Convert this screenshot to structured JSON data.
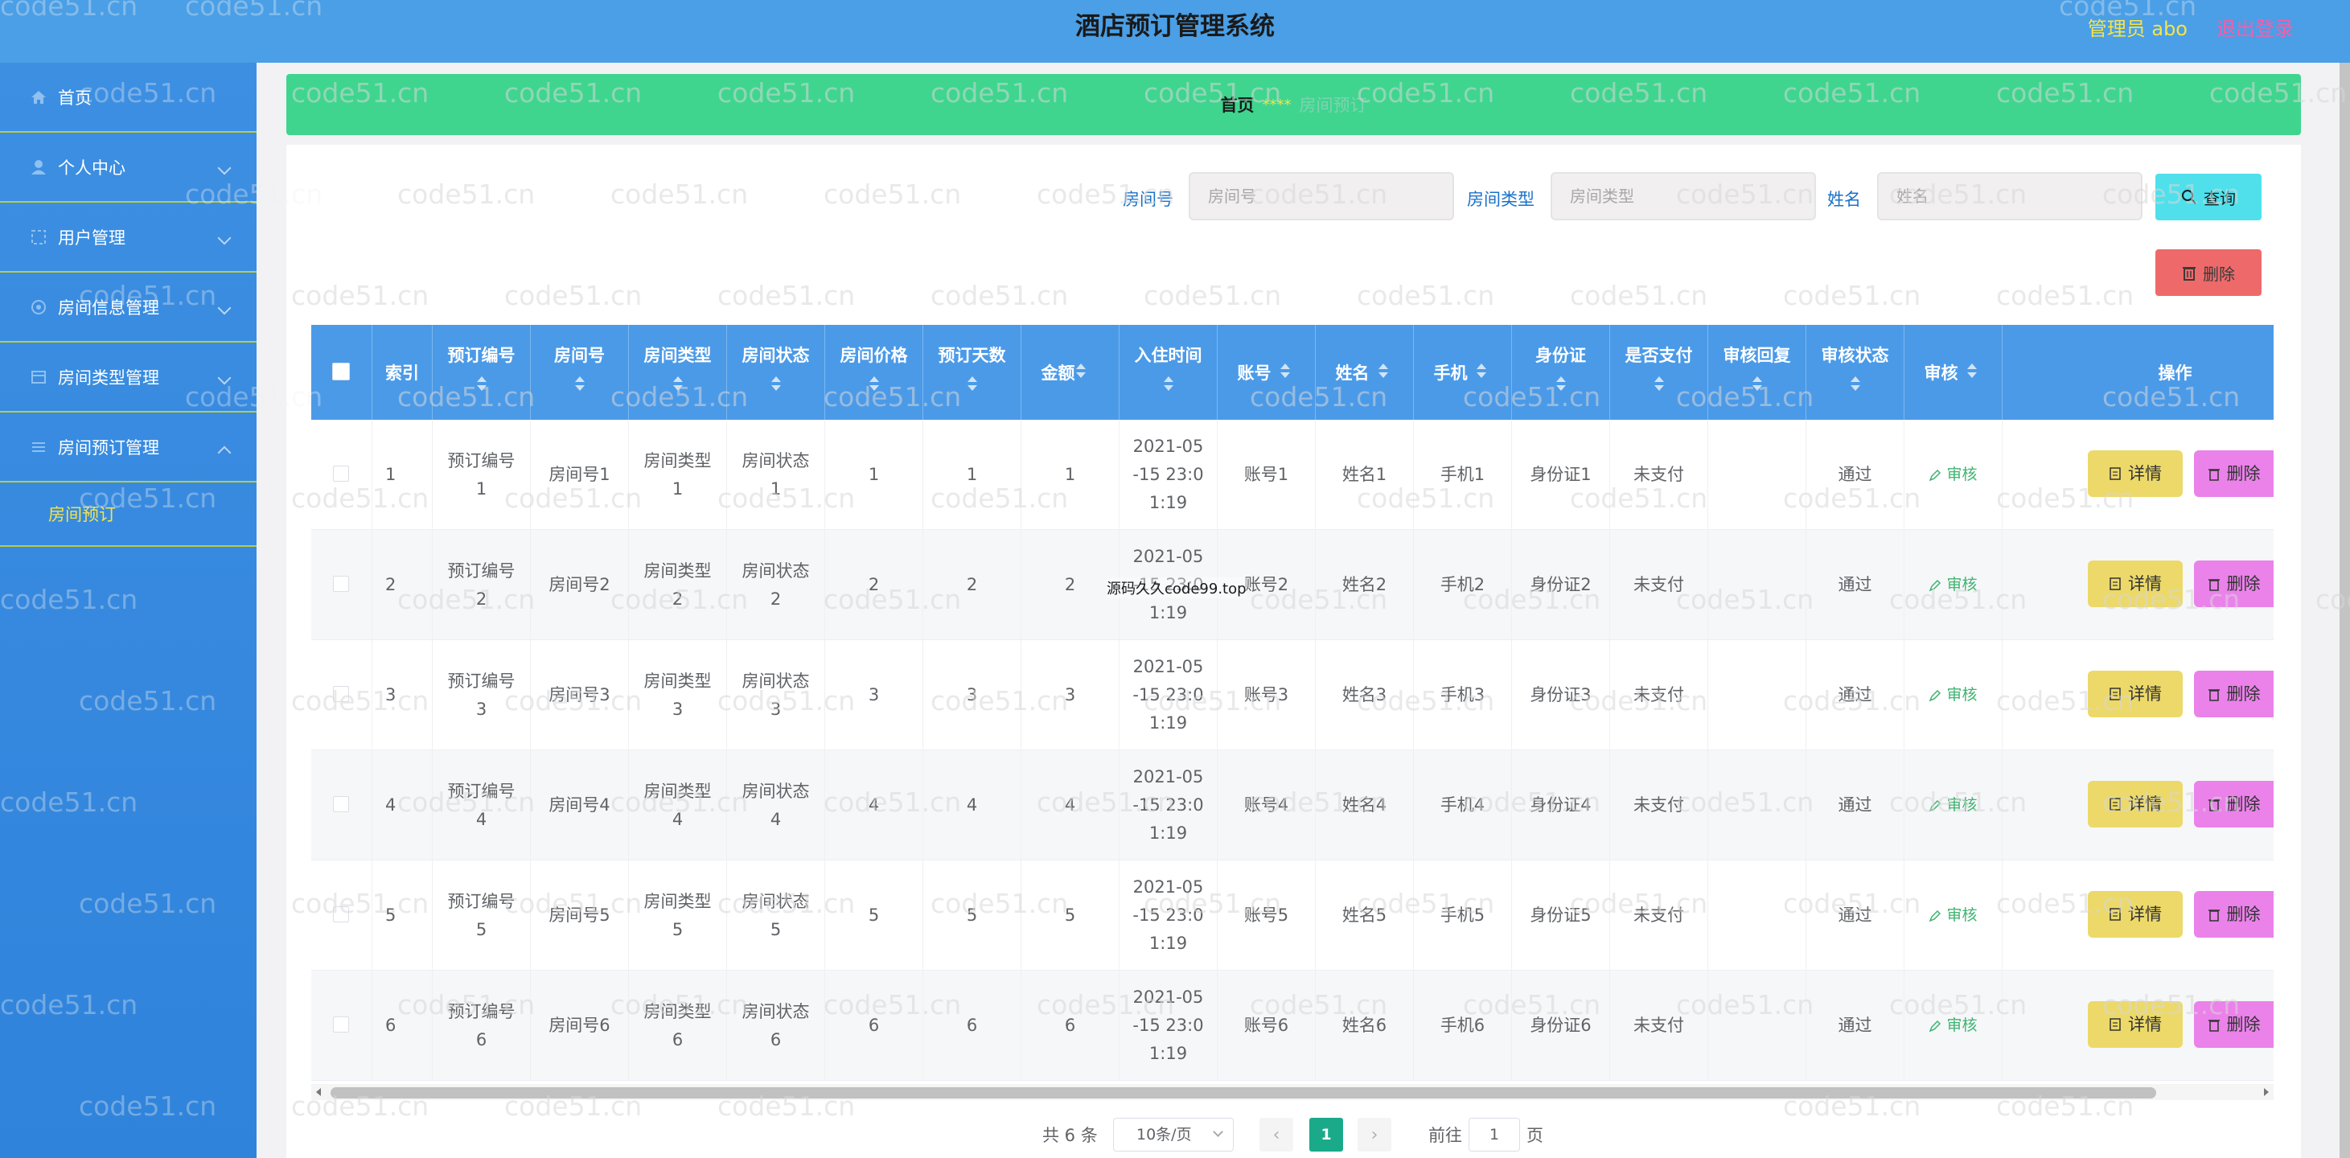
{
  "header": {
    "title": "酒店预订管理系统",
    "user": "管理员 abo",
    "logout": "退出登录"
  },
  "sidebar": {
    "items": [
      {
        "label": "首页",
        "icon": "home-icon",
        "chevron": ""
      },
      {
        "label": "个人中心",
        "icon": "user-icon",
        "chevron": "down"
      },
      {
        "label": "用户管理",
        "icon": "users-icon",
        "chevron": "down"
      },
      {
        "label": "房间信息管理",
        "icon": "gear-icon",
        "chevron": "down"
      },
      {
        "label": "房间类型管理",
        "icon": "grid-icon",
        "chevron": "down"
      },
      {
        "label": "房间预订管理",
        "icon": "list-icon",
        "chevron": "up"
      }
    ],
    "sub_item": "房间预订"
  },
  "breadcrumb": {
    "home": "首页",
    "separator": "****",
    "current": "房间预订"
  },
  "search": {
    "room_no_label": "房间号",
    "room_no_placeholder": "房间号",
    "room_type_label": "房间类型",
    "room_type_placeholder": "房间类型",
    "name_label": "姓名",
    "name_placeholder": "姓名",
    "search_btn": "查询",
    "delete_btn": "删除"
  },
  "table": {
    "columns": [
      "索引",
      "预订编号",
      "房间号",
      "房间类型",
      "房间状态",
      "房间价格",
      "预订天数",
      "金额",
      "入住时间",
      "账号",
      "姓名",
      "手机",
      "身份证",
      "是否支付",
      "审核回复",
      "审核状态",
      "审核",
      "操作"
    ],
    "audit_link": "审核",
    "detail_btn": "详情",
    "delete_btn": "删除",
    "rows": [
      {
        "idx": "1",
        "code": [
          "预订编号",
          "1"
        ],
        "room": "房间号1",
        "type": [
          "房间类型",
          "1"
        ],
        "status": [
          "房间状态",
          "1"
        ],
        "price": "1",
        "days": "1",
        "amount": "1",
        "checkin": [
          "2021-05",
          "-15 23:0",
          "1:19"
        ],
        "account": "账号1",
        "name": "姓名1",
        "phone": "手机1",
        "idcard": "身份证1",
        "paid": "未支付",
        "reply": "",
        "audit_status": "通过"
      },
      {
        "idx": "2",
        "code": [
          "预订编号",
          "2"
        ],
        "room": "房间号2",
        "type": [
          "房间类型",
          "2"
        ],
        "status": [
          "房间状态",
          "2"
        ],
        "price": "2",
        "days": "2",
        "amount": "2",
        "checkin": [
          "2021-05",
          "-15 23:0",
          "1:19"
        ],
        "account": "账号2",
        "name": "姓名2",
        "phone": "手机2",
        "idcard": "身份证2",
        "paid": "未支付",
        "reply": "",
        "audit_status": "通过"
      },
      {
        "idx": "3",
        "code": [
          "预订编号",
          "3"
        ],
        "room": "房间号3",
        "type": [
          "房间类型",
          "3"
        ],
        "status": [
          "房间状态",
          "3"
        ],
        "price": "3",
        "days": "3",
        "amount": "3",
        "checkin": [
          "2021-05",
          "-15 23:0",
          "1:19"
        ],
        "account": "账号3",
        "name": "姓名3",
        "phone": "手机3",
        "idcard": "身份证3",
        "paid": "未支付",
        "reply": "",
        "audit_status": "通过"
      },
      {
        "idx": "4",
        "code": [
          "预订编号",
          "4"
        ],
        "room": "房间号4",
        "type": [
          "房间类型",
          "4"
        ],
        "status": [
          "房间状态",
          "4"
        ],
        "price": "4",
        "days": "4",
        "amount": "4",
        "checkin": [
          "2021-05",
          "-15 23:0",
          "1:19"
        ],
        "account": "账号4",
        "name": "姓名4",
        "phone": "手机4",
        "idcard": "身份证4",
        "paid": "未支付",
        "reply": "",
        "audit_status": "通过"
      },
      {
        "idx": "5",
        "code": [
          "预订编号",
          "5"
        ],
        "room": "房间号5",
        "type": [
          "房间类型",
          "5"
        ],
        "status": [
          "房间状态",
          "5"
        ],
        "price": "5",
        "days": "5",
        "amount": "5",
        "checkin": [
          "2021-05",
          "-15 23:0",
          "1:19"
        ],
        "account": "账号5",
        "name": "姓名5",
        "phone": "手机5",
        "idcard": "身份证5",
        "paid": "未支付",
        "reply": "",
        "audit_status": "通过"
      },
      {
        "idx": "6",
        "code": [
          "预订编号",
          "6"
        ],
        "room": "房间号6",
        "type": [
          "房间类型",
          "6"
        ],
        "status": [
          "房间状态",
          "6"
        ],
        "price": "6",
        "days": "6",
        "amount": "6",
        "checkin": [
          "2021-05",
          "-15 23:0",
          "1:19"
        ],
        "account": "账号6",
        "name": "姓名6",
        "phone": "手机6",
        "idcard": "身份证6",
        "paid": "未支付",
        "reply": "",
        "audit_status": "通过"
      }
    ]
  },
  "pagination": {
    "total": "共 6 条",
    "page_size": "10条/页",
    "current": "1",
    "goto_label": "前往",
    "goto_value": "1",
    "page_suffix": "页"
  },
  "watermark": "code51.cn",
  "center_note": "源码久久code99.top",
  "colors": {
    "header": "#4a9fe6",
    "sidebar": "#3d8fe2",
    "breadcrumb_bar": "#3fd58f",
    "table_header": "#4b9ae8",
    "search_btn": "#4fe0ec",
    "delete_btn": "#ee6a6a",
    "detail_btn": "#ecd969",
    "row_delete_btn": "#ea82ea",
    "pager_active": "#1aaa8a"
  }
}
